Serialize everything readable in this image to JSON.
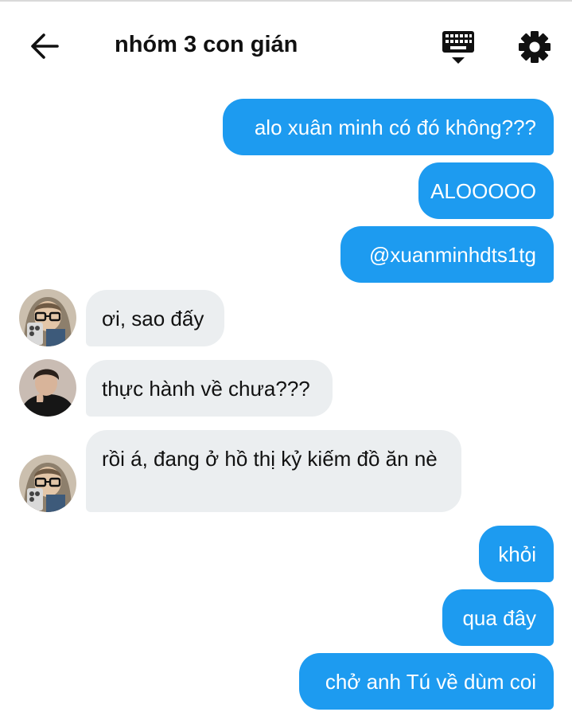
{
  "header": {
    "title": "nhóm 3 con gián",
    "back_icon": "arrow-left-icon",
    "keyboard_icon": "keyboard-hide-icon",
    "settings_icon": "gear-icon"
  },
  "messages": [
    {
      "sender": "me",
      "text": "alo xuân minh có đó không???"
    },
    {
      "sender": "me",
      "text": "ALOOOOO"
    },
    {
      "sender": "me",
      "text": "@xuanminhdts1tg"
    },
    {
      "sender": "other",
      "avatar": "avatar-hood-glasses",
      "text": "ơi, sao đấy"
    },
    {
      "sender": "other",
      "avatar": "avatar-dark-shirt",
      "text": "thực hành về chưa???"
    },
    {
      "sender": "other",
      "avatar": "avatar-hood-glasses",
      "text": "rồi á, đang ở hồ thị kỷ kiếm đồ ăn nè"
    },
    {
      "sender": "me",
      "text": "khỏi"
    },
    {
      "sender": "me",
      "text": "qua đây"
    },
    {
      "sender": "me",
      "text": "chở anh Tú về dùm coi"
    }
  ],
  "colors": {
    "outgoing_bubble": "#1d9bf0",
    "incoming_bubble": "#ebeef0",
    "text_dark": "#111111"
  }
}
